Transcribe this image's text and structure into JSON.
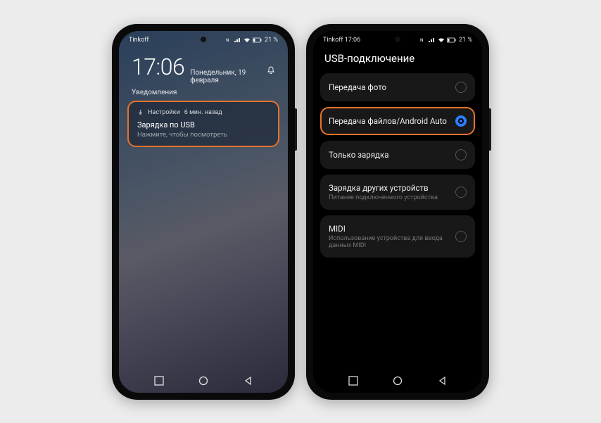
{
  "phone1": {
    "status": {
      "left": "Tinkoff",
      "battery": "21 %"
    },
    "clock": "17:06",
    "date": "Понедельник, 19 февраля",
    "notifications_label": "Уведомления",
    "notification": {
      "app": "Настройки",
      "time": "6 мин. назад",
      "title": "Зарядка по USB",
      "subtitle": "Нажмите, чтобы посмотреть"
    }
  },
  "phone2": {
    "status": {
      "left": "Tinkoff 17:06",
      "battery": "21 %"
    },
    "title": "USB-подключение",
    "options": [
      {
        "label": "Передача фото",
        "sub": "",
        "selected": false,
        "highlight": false
      },
      {
        "label": "Передача файлов/Android Auto",
        "sub": "",
        "selected": true,
        "highlight": true
      },
      {
        "label": "Только зарядка",
        "sub": "",
        "selected": false,
        "highlight": false
      },
      {
        "label": "Зарядка других устройств",
        "sub": "Питание подключенного устройства",
        "selected": false,
        "highlight": false
      },
      {
        "label": "MIDI",
        "sub": "Использование устройства для ввода данных MIDI",
        "selected": false,
        "highlight": false
      }
    ]
  }
}
